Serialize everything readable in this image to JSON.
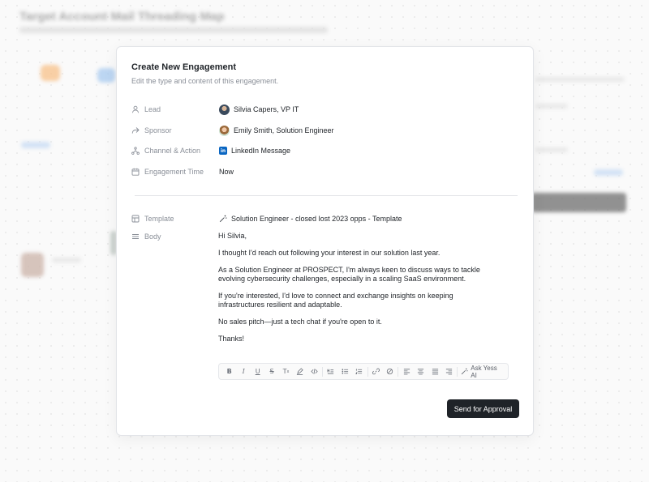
{
  "background": {
    "page_title": "Target Account Mail Threading Map"
  },
  "modal": {
    "title": "Create New Engagement",
    "subtitle": "Edit the type and content of this engagement.",
    "fields": {
      "lead": {
        "label": "Lead",
        "value": "Silvia Capers, VP IT"
      },
      "sponsor": {
        "label": "Sponsor",
        "value": "Emily Smith, Solution Engineer"
      },
      "channel": {
        "label": "Channel & Action",
        "value": "LinkedIn Message",
        "icon": "linkedin-icon"
      },
      "time": {
        "label": "Engagement Time",
        "value": "Now"
      },
      "template": {
        "label": "Template",
        "value": "Solution Engineer - closed lost 2023 opps - Template",
        "icon": "magic-wand-icon"
      },
      "body": {
        "label": "Body"
      }
    },
    "body_paragraphs": [
      "Hi Silvia,",
      "I thought I'd reach out following your interest in our solution last year.",
      "As a Solution Engineer at PROSPECT, I'm always keen to discuss ways to tackle evolving cybersecurity challenges, especially in a scaling SaaS environment.",
      "If you're interested, I'd love to connect and exchange insights on keeping infrastructures resilient and adaptable.",
      "No sales pitch—just a tech chat if you're open to it.",
      "Thanks!"
    ],
    "toolbar": {
      "ai_label": "Ask Yess AI"
    },
    "send_label": "Send for Approval"
  },
  "colors": {
    "primary_button": "#1f2328",
    "linkedin": "#0a66c2",
    "muted_text": "#8a8f98"
  }
}
